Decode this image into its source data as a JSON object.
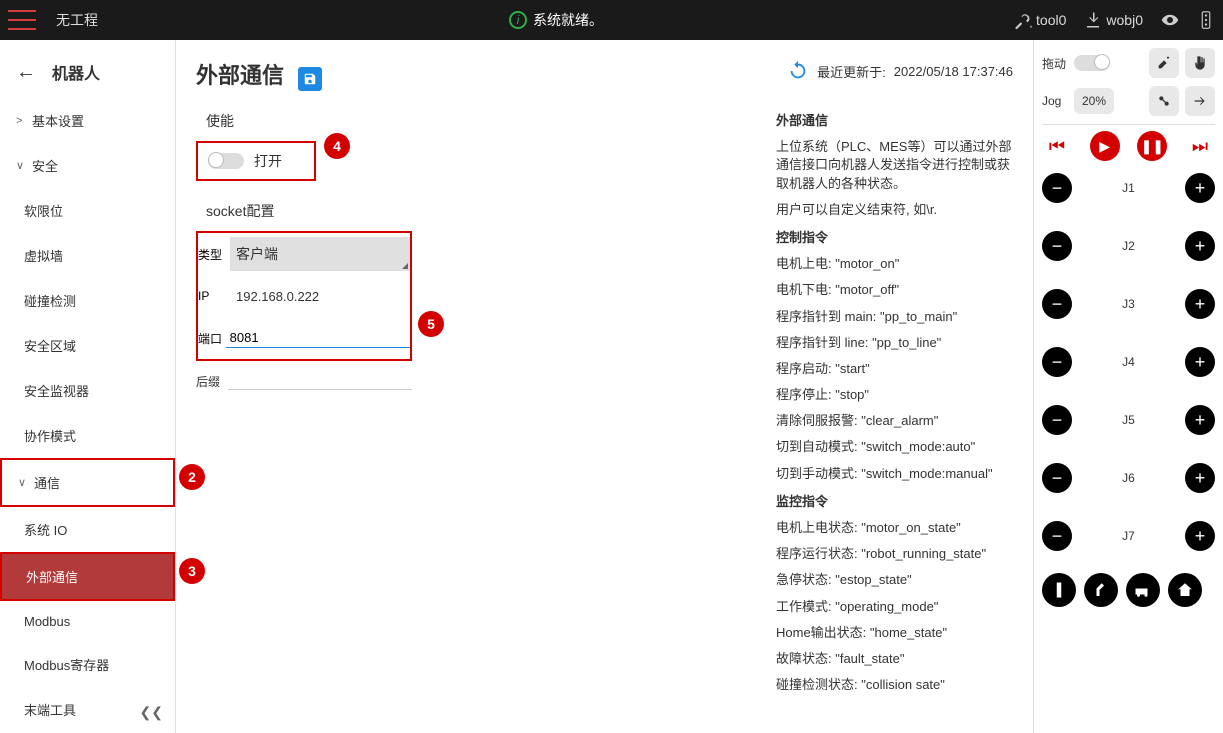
{
  "topbar": {
    "project": "无工程",
    "status": "系统就绪。",
    "tool": "tool0",
    "wobj": "wobj0"
  },
  "sidebar": {
    "title": "机器人",
    "items": [
      {
        "label": "基本设置",
        "expand": ">"
      },
      {
        "label": "安全",
        "expand": "∨"
      },
      {
        "label": "软限位",
        "child": true
      },
      {
        "label": "虚拟墙",
        "child": true
      },
      {
        "label": "碰撞检测",
        "child": true
      },
      {
        "label": "安全区域",
        "child": true
      },
      {
        "label": "安全监视器",
        "child": true
      },
      {
        "label": "协作模式",
        "child": true
      },
      {
        "label": "通信",
        "expand": "∨",
        "redbox": true,
        "marker": "2"
      },
      {
        "label": "系统 IO",
        "child": true
      },
      {
        "label": "外部通信",
        "child": true,
        "selected": true,
        "redbox": true,
        "marker": "3"
      },
      {
        "label": "Modbus",
        "child": true
      },
      {
        "label": "Modbus寄存器",
        "child": true
      },
      {
        "label": "末端工具",
        "child": true
      }
    ]
  },
  "markers": {
    "4": "4",
    "5": "5"
  },
  "page": {
    "title": "外部通信",
    "enable_label": "使能",
    "enable_state": "打开",
    "socket_title": "socket配置",
    "type_label": "类型",
    "type_value": "客户端",
    "ip_label": "IP",
    "ip_value": "192.168.0.222",
    "port_label": "端口",
    "port_value": "8081",
    "suffix_label": "后缀",
    "last_updated_label": "最近更新于:",
    "last_updated_value": "2022/05/18 17:37:46"
  },
  "doc": {
    "h1": "外部通信",
    "p1": "上位系统（PLC、MES等）可以通过外部通信接口向机器人发送指令进行控制或获取机器人的各种状态。",
    "p2": "用户可以自定义结束符, 如\\r.",
    "h2": "控制指令",
    "cmds": [
      "电机上电: \"motor_on\"",
      "电机下电: \"motor_off\"",
      "程序指针到 main: \"pp_to_main\"",
      "程序指针到 line: \"pp_to_line\"",
      "程序启动: \"start\"",
      "程序停止: \"stop\"",
      "清除伺服报警: \"clear_alarm\"",
      "切到自动模式: \"switch_mode:auto\"",
      "切到手动模式: \"switch_mode:manual\""
    ],
    "h3": "监控指令",
    "mon": [
      "电机上电状态: \"motor_on_state\"",
      "程序运行状态: \"robot_running_state\"",
      "急停状态: \"estop_state\"",
      "工作模式: \"operating_mode\"",
      "Home输出状态: \"home_state\"",
      "故障状态: \"fault_state\"",
      "碰撞检测状态: \"collision sate\""
    ]
  },
  "rightpanel": {
    "drag_label": "拖动",
    "jog_label": "Jog",
    "speed": "20%",
    "joints": [
      "J1",
      "J2",
      "J3",
      "J4",
      "J5",
      "J6",
      "J7"
    ]
  }
}
